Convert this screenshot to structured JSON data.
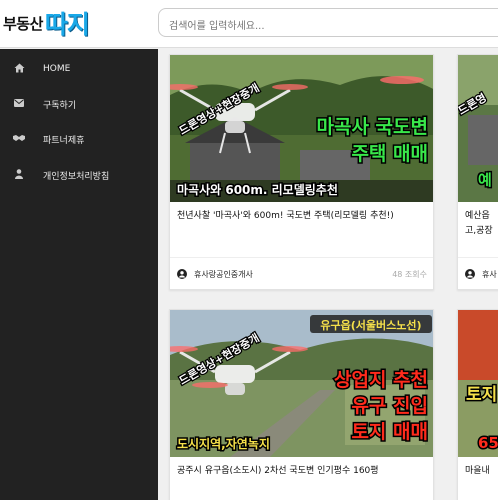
{
  "header": {
    "logo_prefix": "부동산",
    "logo_main": "따지",
    "search_placeholder": "검색어를 입력하세요..."
  },
  "sidebar": {
    "items": [
      {
        "label": "HOME",
        "icon": "home-icon"
      },
      {
        "label": "구독하기",
        "icon": "envelope-icon"
      },
      {
        "label": "파트너제휴",
        "icon": "handshake-icon"
      },
      {
        "label": "개인정보처리방침",
        "icon": "user-icon"
      }
    ]
  },
  "posts": [
    {
      "thumb_tag": "드론영상+현장중개",
      "thumb_line1": "마곡사 국도변",
      "thumb_line2": "주택 매매",
      "thumb_caption": "마곡사와 600m. 리모델링추천",
      "title": "천년사찰 '마곡사'와 600m! 국도변 주택(리모델링 추천!)",
      "author": "휴사랑공인중개사",
      "views": "48 조회수"
    },
    {
      "thumb_tag": "드론영",
      "thumb_caption": "예",
      "title": "예산읍\n고,공장",
      "author": "휴사"
    },
    {
      "thumb_tag": "드론영상+현장중개",
      "thumb_badge": "유구읍(서울버스노선)",
      "thumb_line1": "상업지 추천",
      "thumb_line2": "유구 진입",
      "thumb_line3": "토지 매매",
      "thumb_caption": "도시지역,자연녹지",
      "title": "공주시 유구읍(소도시) 2차선 국도변 인기평수 160평"
    },
    {
      "thumb_tag": "토지",
      "thumb_caption": "65",
      "title": "마을내"
    }
  ],
  "colors": {
    "sidebar_bg": "#222222",
    "logo_blue": "#19a8e8",
    "thumb_green_text": "#39e84a",
    "thumb_red_text": "#ff2b1c"
  }
}
